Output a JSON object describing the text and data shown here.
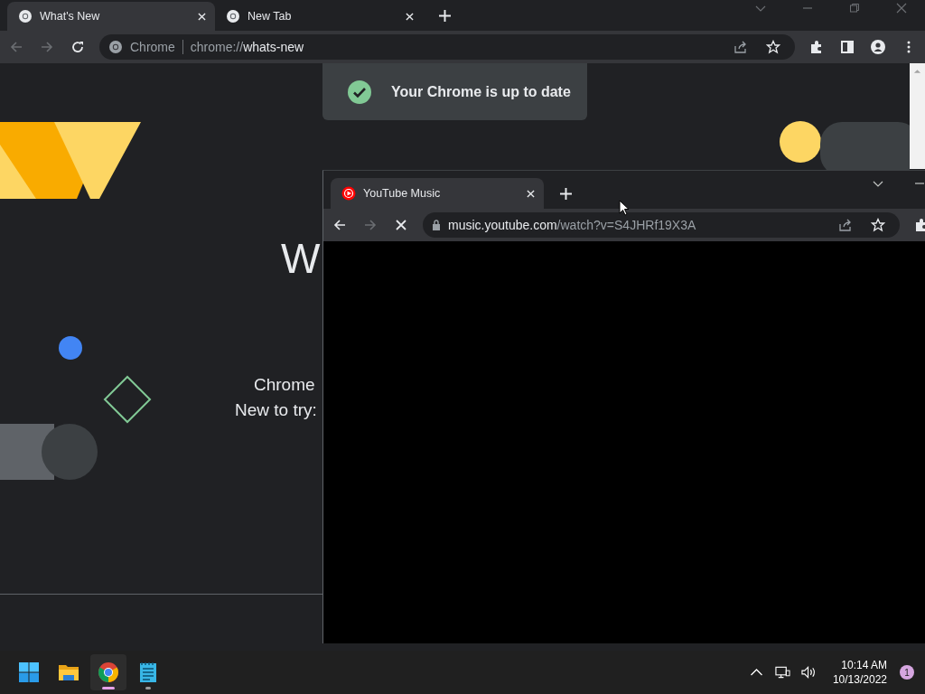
{
  "main_window": {
    "tabs": [
      {
        "title": "What's New",
        "selected": true
      },
      {
        "title": "New Tab",
        "selected": false
      }
    ],
    "omnibox": {
      "site_label": "Chrome",
      "url_prefix": "chrome://",
      "url_host": "whats-new"
    },
    "toast": "Your Chrome is up to date",
    "heading": "W",
    "body_lines": [
      "Chrome",
      "New to try:"
    ]
  },
  "popup_window": {
    "tabs": [
      {
        "title": "YouTube Music",
        "selected": true
      }
    ],
    "url_host": "music.youtube.com",
    "url_path": "/watch?v=S4JHRf19X3A",
    "loading": true
  },
  "taskbar": {
    "apps": [
      {
        "kind": "start",
        "selected": false,
        "running": false
      },
      {
        "kind": "explorer",
        "selected": false,
        "running": false
      },
      {
        "kind": "chrome",
        "selected": true,
        "running": true
      },
      {
        "kind": "notepad",
        "selected": false,
        "running": true
      }
    ],
    "time": "10:14 AM",
    "date": "10/13/2022",
    "notification_count": "1"
  }
}
